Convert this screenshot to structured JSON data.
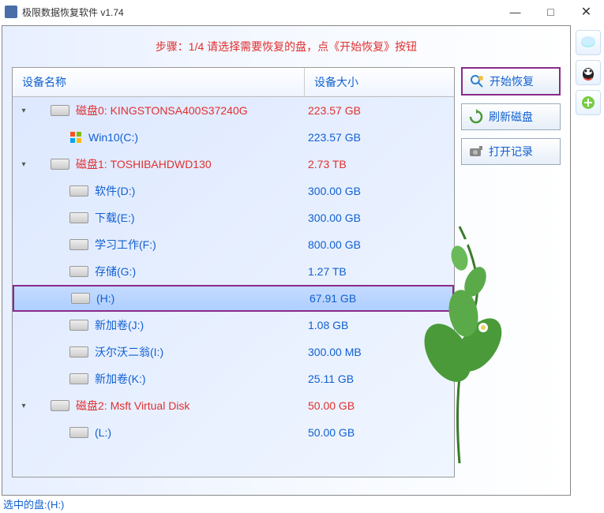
{
  "window": {
    "title": "极限数据恢复软件 v1.74",
    "min": "—",
    "max": "□",
    "close": "✕"
  },
  "step_text": "步骤：1/4 请选择需要恢复的盘，点《开始恢复》按钮",
  "columns": {
    "name": "设备名称",
    "size": "设备大小"
  },
  "tree": [
    {
      "type": "disk",
      "indent": 0,
      "chev": "▾",
      "label": "磁盘0: KINGSTONSA400S37240G",
      "size": "223.57 GB",
      "icon": "disk"
    },
    {
      "type": "part",
      "indent": 1,
      "chev": "",
      "label": "Win10(C:)",
      "size": "223.57 GB",
      "icon": "win"
    },
    {
      "type": "disk",
      "indent": 0,
      "chev": "▾",
      "label": "磁盘1: TOSHIBAHDWD130",
      "size": "2.73 TB",
      "icon": "disk"
    },
    {
      "type": "part",
      "indent": 1,
      "chev": "",
      "label": "软件(D:)",
      "size": "300.00 GB",
      "icon": "disk"
    },
    {
      "type": "part",
      "indent": 1,
      "chev": "",
      "label": "下载(E:)",
      "size": "300.00 GB",
      "icon": "disk"
    },
    {
      "type": "part",
      "indent": 1,
      "chev": "",
      "label": "学习工作(F:)",
      "size": "800.00 GB",
      "icon": "disk"
    },
    {
      "type": "part",
      "indent": 1,
      "chev": "",
      "label": "存储(G:)",
      "size": "1.27 TB",
      "icon": "disk"
    },
    {
      "type": "part",
      "indent": 1,
      "chev": "",
      "label": "(H:)",
      "size": "67.91 GB",
      "icon": "disk",
      "selected": true,
      "highlight": true
    },
    {
      "type": "part",
      "indent": 1,
      "chev": "",
      "label": "新加卷(J:)",
      "size": "1.08 GB",
      "icon": "disk"
    },
    {
      "type": "part",
      "indent": 1,
      "chev": "",
      "label": "沃尔沃二翁(I:)",
      "size": "300.00 MB",
      "icon": "disk"
    },
    {
      "type": "part",
      "indent": 1,
      "chev": "",
      "label": "新加卷(K:)",
      "size": "25.11 GB",
      "icon": "disk"
    },
    {
      "type": "disk",
      "indent": 0,
      "chev": "▾",
      "label": "磁盘2: Msft     Virtual Disk",
      "size": "50.00 GB",
      "icon": "disk"
    },
    {
      "type": "part",
      "indent": 1,
      "chev": "",
      "label": "(L:)",
      "size": "50.00 GB",
      "icon": "disk"
    }
  ],
  "actions": {
    "start": "开始恢复",
    "refresh": "刷新磁盘",
    "open_log": "打开记录"
  },
  "status": "选中的盘:(H:)"
}
